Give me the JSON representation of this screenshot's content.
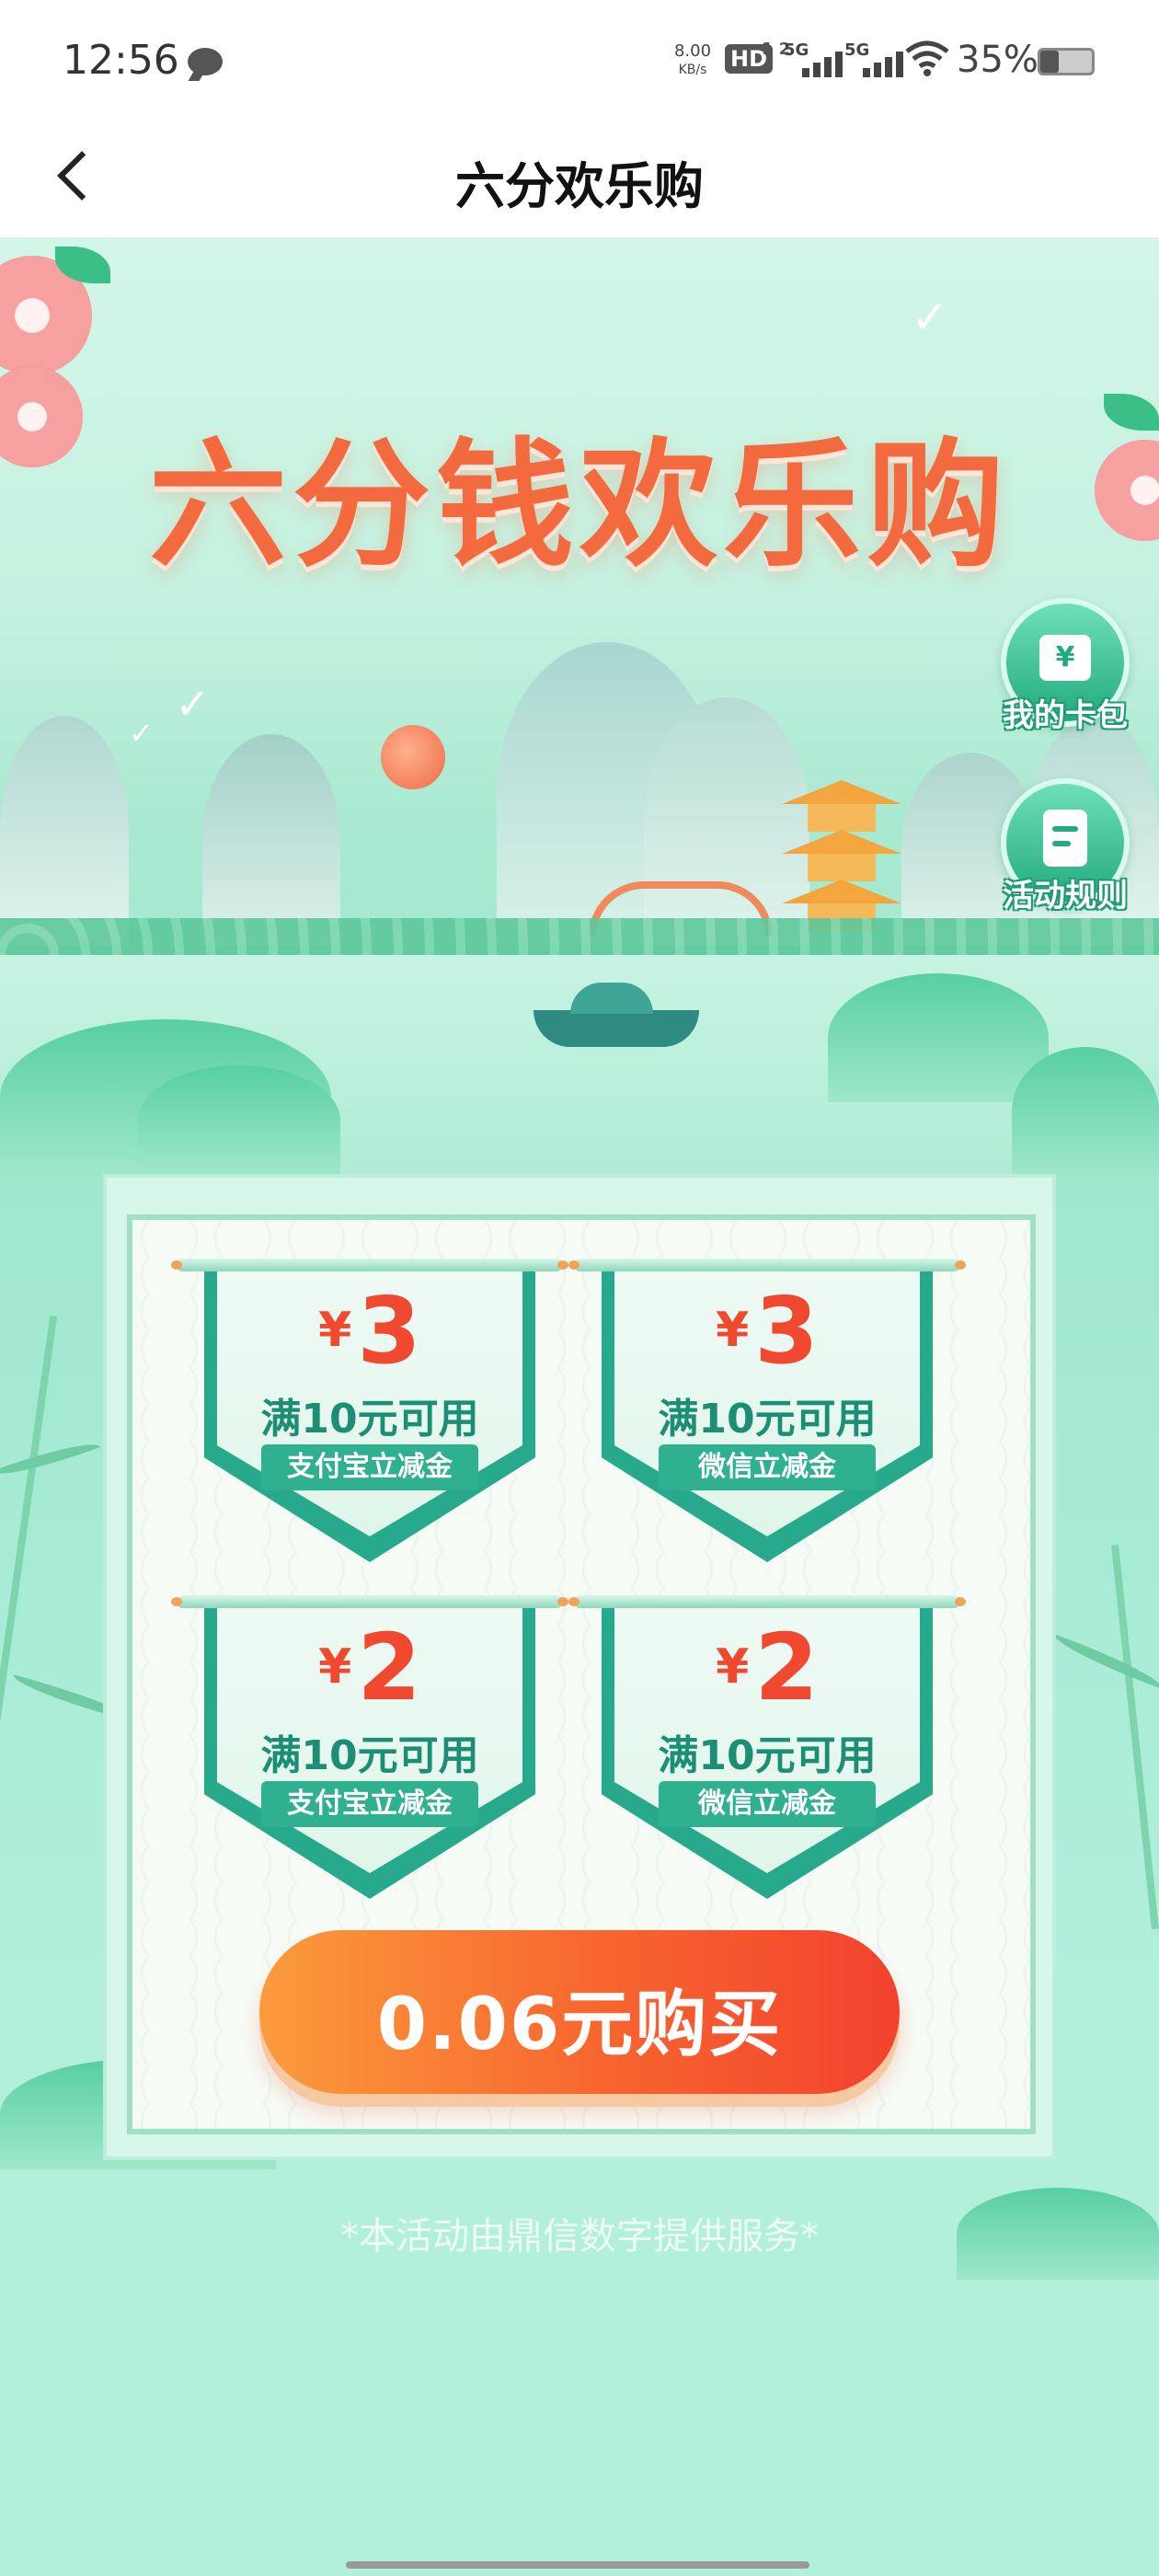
{
  "status_bar": {
    "time": "12:56",
    "net_speed_value": "8.00",
    "net_speed_unit": "KB/s",
    "hd_label": "HD",
    "hd_sub": "1 2",
    "sim1_label": "5G",
    "sim2_label": "5G",
    "battery_text": "35%",
    "battery_level": 0.35
  },
  "title_bar": {
    "title": "六分欢乐购"
  },
  "hero": {
    "headline": "六分钱欢乐购"
  },
  "side_buttons": {
    "wallet_label": "我的卡包",
    "wallet_glyph": "¥",
    "rules_label": "活动规则"
  },
  "coupons": [
    {
      "currency": "¥",
      "amount": "3",
      "condition": "满10元可用",
      "tag": "支付宝立减金"
    },
    {
      "currency": "¥",
      "amount": "3",
      "condition": "满10元可用",
      "tag": "微信立减金"
    },
    {
      "currency": "¥",
      "amount": "2",
      "condition": "满10元可用",
      "tag": "支付宝立减金"
    },
    {
      "currency": "¥",
      "amount": "2",
      "condition": "满10元可用",
      "tag": "微信立减金"
    }
  ],
  "buy_button": {
    "label": "0.06元购买"
  },
  "footer": {
    "text": "*本活动由鼎信数字提供服务*"
  },
  "colors": {
    "headline": "#f26a3d",
    "accent_green": "#27a98b",
    "price_red": "#f0492f",
    "button_orange": "#f7642e"
  }
}
